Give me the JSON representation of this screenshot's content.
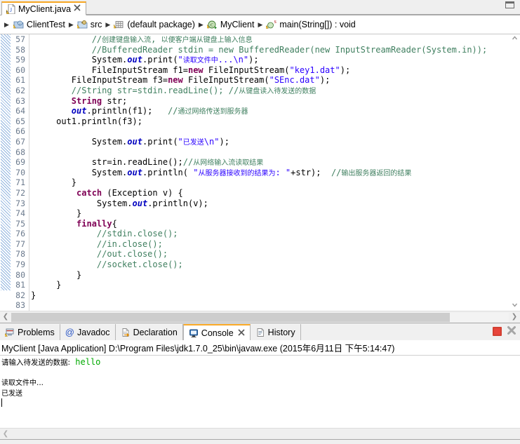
{
  "window": {
    "maximize_label": "□"
  },
  "editor_tab": {
    "icon": "java-file-warning-icon",
    "label": "MyClient.java",
    "close_label": "✕"
  },
  "breadcrumb": {
    "separator": "▶",
    "items": [
      {
        "icon": "java-project-icon",
        "label": "ClientTest"
      },
      {
        "icon": "source-folder-icon",
        "label": "src"
      },
      {
        "icon": "package-icon",
        "label": "(default package)"
      },
      {
        "icon": "class-icon",
        "label": "MyClient"
      },
      {
        "icon": "method-static-icon",
        "label": "main(String[]) : void"
      }
    ]
  },
  "editor": {
    "first_line": 57,
    "lines": [
      {
        "n": 57,
        "text": "            //创建键盘输入流, 以便客户端从键盘上输入信息"
      },
      {
        "n": 58,
        "text": "            //BufferedReader stdin = new BufferedReader(new InputStreamReader(System.in));"
      },
      {
        "n": 59,
        "text": "            System.out.print(\"读取文件中...\\n\");"
      },
      {
        "n": 60,
        "text": "            FileInputStream f1=new FileInputStream(\"key1.dat\");"
      },
      {
        "n": 61,
        "text": "        FileInputStream f3=new FileInputStream(\"SEnc.dat\");"
      },
      {
        "n": 62,
        "text": "        //String str=stdin.readLine(); //从键盘读入待发送的数据"
      },
      {
        "n": 63,
        "text": "        String str;"
      },
      {
        "n": 64,
        "text": "        out.println(f1);   //通过网络传送到服务器"
      },
      {
        "n": 65,
        "text": "     out1.println(f3);"
      },
      {
        "n": 66,
        "text": ""
      },
      {
        "n": 67,
        "text": "            System.out.print(\"已发送\\n\");"
      },
      {
        "n": 68,
        "text": ""
      },
      {
        "n": 69,
        "text": "            str=in.readLine();//从网络输入流读取结果"
      },
      {
        "n": 70,
        "text": "            System.out.println( \"从服务器接收到的结果为: \"+str);  //输出服务器返回的结果"
      },
      {
        "n": 71,
        "text": "        }"
      },
      {
        "n": 72,
        "text": "         catch (Exception v) {"
      },
      {
        "n": 73,
        "text": "             System.out.println(v);"
      },
      {
        "n": 74,
        "text": "         }"
      },
      {
        "n": 75,
        "text": "         finally{"
      },
      {
        "n": 76,
        "text": "             //stdin.close();"
      },
      {
        "n": 77,
        "text": "             //in.close();"
      },
      {
        "n": 78,
        "text": "             //out.close();"
      },
      {
        "n": 79,
        "text": "             //socket.close();"
      },
      {
        "n": 80,
        "text": "         }"
      },
      {
        "n": 81,
        "text": "     }"
      },
      {
        "n": 82,
        "text": "}"
      },
      {
        "n": 83,
        "text": ""
      }
    ],
    "scroll_left_label": "❮",
    "scroll_right_label": "❯",
    "scroll_up_label": "▲",
    "scroll_down_label": "▼"
  },
  "bottom_panel": {
    "tabs": [
      {
        "icon": "problems-icon",
        "label": "Problems",
        "active": false,
        "closeable": false
      },
      {
        "icon": "javadoc-icon",
        "label": "Javadoc",
        "active": false,
        "closeable": false
      },
      {
        "icon": "declaration-icon",
        "label": "Declaration",
        "active": false,
        "closeable": false
      },
      {
        "icon": "console-icon",
        "label": "Console",
        "active": true,
        "closeable": true
      },
      {
        "icon": "history-icon",
        "label": "History",
        "active": false,
        "closeable": false
      }
    ],
    "tab_close_label": "✕",
    "tools": [
      {
        "icon": "terminate-icon",
        "name": "terminate-button"
      },
      {
        "icon": "remove-launch-icon",
        "name": "remove-launch-button"
      }
    ]
  },
  "console": {
    "header": "MyClient [Java Application] D:\\Program Files\\jdk1.7.0_25\\bin\\javaw.exe (2015年6月11日 下午5:14:47)",
    "prompt_text": "请输入待发送的数据:",
    "input_value": "hello",
    "output_lines": [
      "",
      "读取文件中...",
      "已发送"
    ],
    "scroll_left_label": "❮"
  }
}
